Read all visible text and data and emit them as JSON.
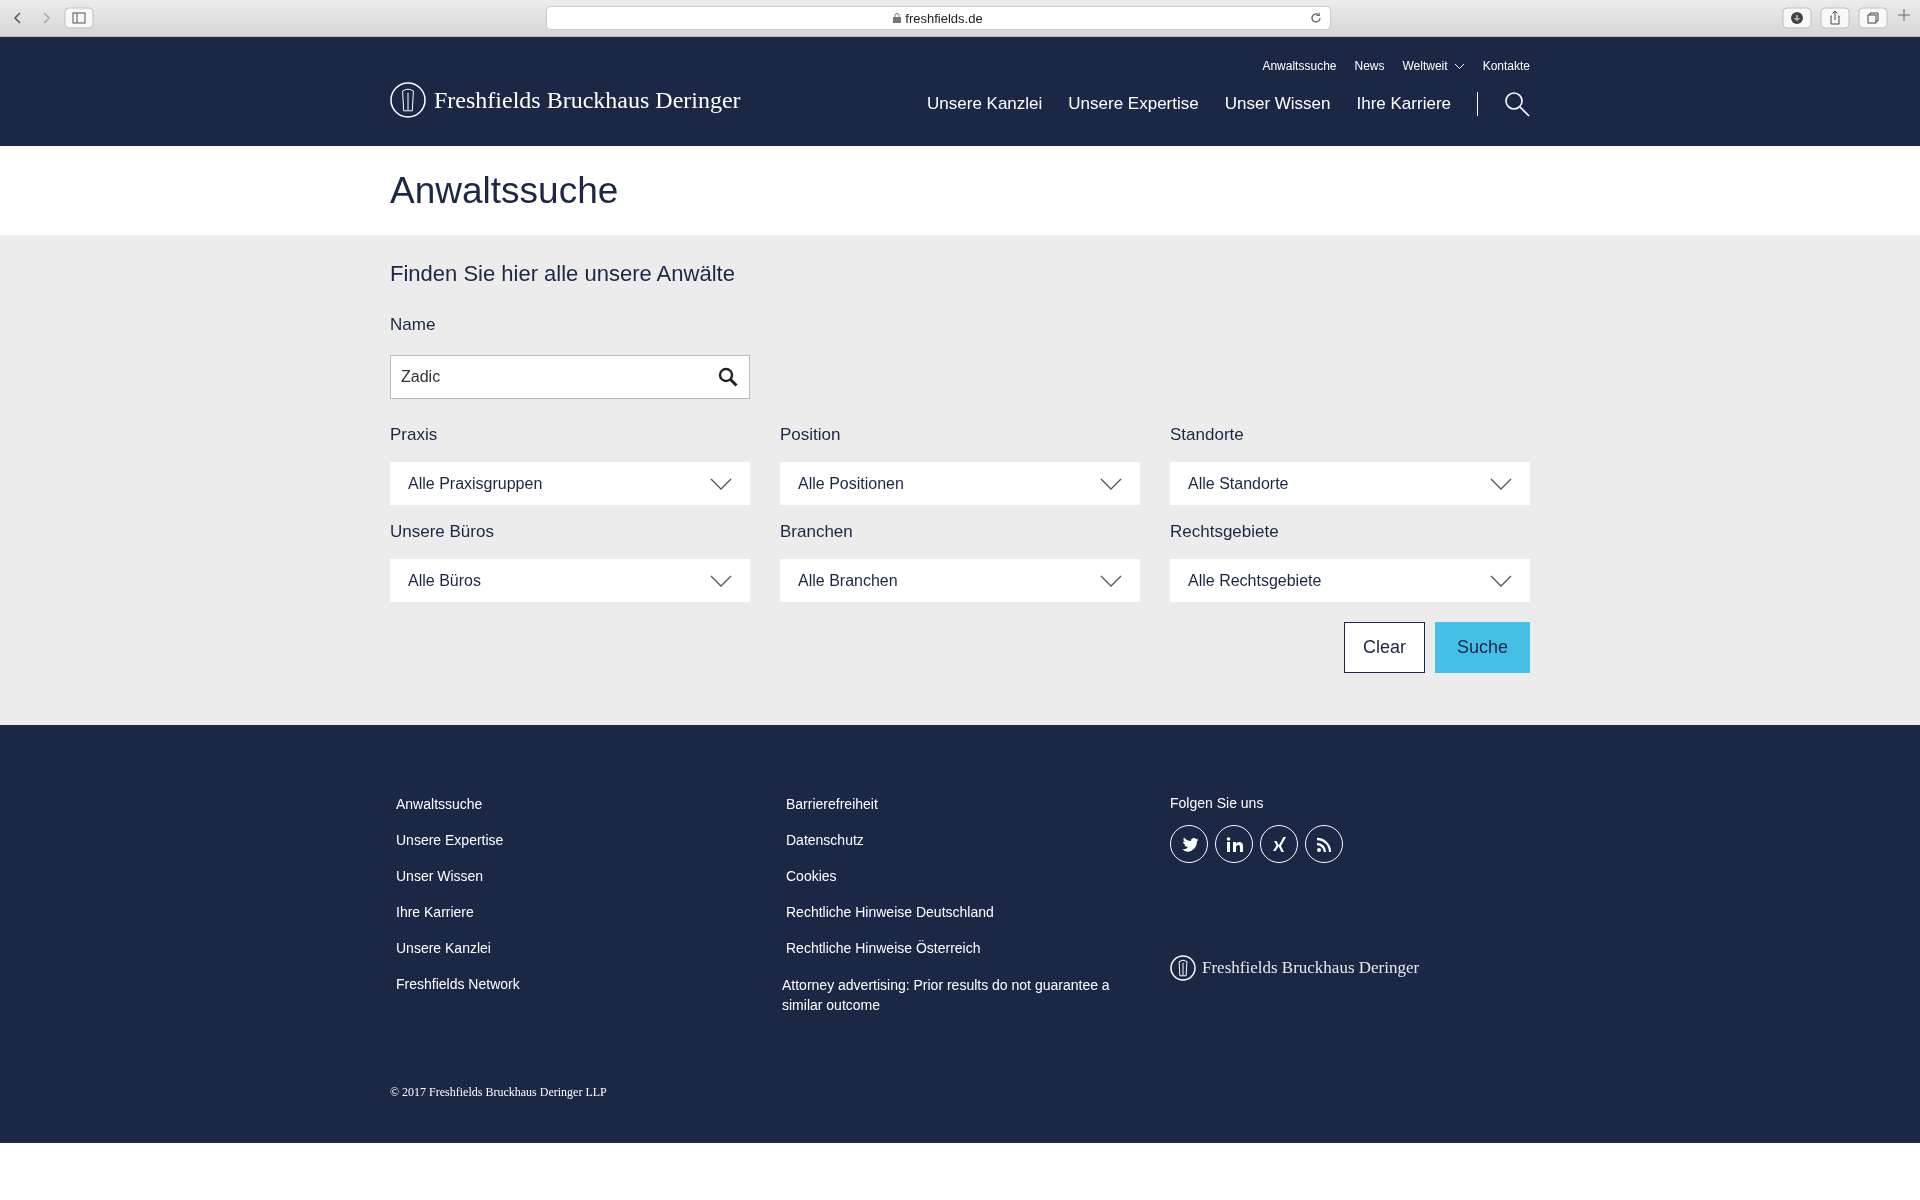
{
  "browser": {
    "url": "freshfields.de"
  },
  "header": {
    "logo_text": "Freshfields Bruckhaus Deringer",
    "utility_nav": [
      {
        "label": "Anwaltssuche",
        "kind": "link"
      },
      {
        "label": "News",
        "kind": "link"
      },
      {
        "label": "Weltweit",
        "kind": "dropdown"
      },
      {
        "label": "Kontakte",
        "kind": "link"
      }
    ],
    "main_nav": [
      "Unsere Kanzlei",
      "Unsere Expertise",
      "Unser Wissen",
      "Ihre Karriere"
    ]
  },
  "page_title": "Anwaltssuche",
  "search": {
    "heading": "Finden Sie hier alle unsere Anwälte",
    "name_label": "Name",
    "name_value": "Zadic",
    "filters": [
      {
        "label": "Praxis",
        "value": "Alle Praxisgruppen"
      },
      {
        "label": "Position",
        "value": "Alle Positionen"
      },
      {
        "label": "Standorte",
        "value": "Alle Standorte"
      },
      {
        "label": "Unsere Büros",
        "value": "Alle Büros"
      },
      {
        "label": "Branchen",
        "value": "Alle Branchen"
      },
      {
        "label": "Rechtsgebiete",
        "value": "Alle Rechtsgebiete"
      }
    ],
    "buttons": [
      {
        "label": "Clear",
        "kind": "secondary"
      },
      {
        "label": "Suche",
        "kind": "primary"
      }
    ]
  },
  "footer": {
    "links_col1": [
      "Anwaltssuche",
      "Unsere Expertise",
      "Unser Wissen",
      "Ihre Karriere",
      "Unsere Kanzlei",
      "Freshfields Network"
    ],
    "links_col2": [
      "Barrierefreiheit",
      "Datenschutz",
      "Cookies",
      "Rechtliche Hinweise Deutschland",
      "Rechtliche Hinweise Österreich",
      "Attorney advertising: Prior results do not guarantee a similar outcome"
    ],
    "follow_heading": "Folgen Sie uns",
    "logo_text": "Freshfields Bruckhaus Deringer",
    "copyright": "© 2017 Freshfields Bruckhaus Deringer LLP"
  }
}
